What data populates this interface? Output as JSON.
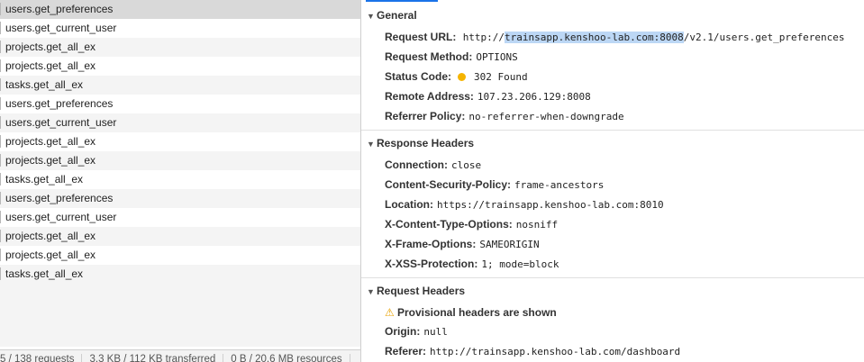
{
  "requests": [
    "users.get_preferences",
    "users.get_current_user",
    "projects.get_all_ex",
    "projects.get_all_ex",
    "tasks.get_all_ex",
    "users.get_preferences",
    "users.get_current_user",
    "projects.get_all_ex",
    "projects.get_all_ex",
    "tasks.get_all_ex",
    "users.get_preferences",
    "users.get_current_user",
    "projects.get_all_ex",
    "projects.get_all_ex",
    "tasks.get_all_ex"
  ],
  "status_bar": {
    "requests": "5 / 138 requests",
    "transferred": "3.3 KB / 112 KB transferred",
    "resources": "0 B / 20.6 MB resources"
  },
  "general": {
    "title": "General",
    "request_url_label": "Request URL:",
    "request_url_prefix": "http://",
    "request_url_host": "trainsapp.kenshoo-lab.com:8008",
    "request_url_path": "/v2.1/users.get_preferences",
    "request_method_label": "Request Method:",
    "request_method": "OPTIONS",
    "status_code_label": "Status Code:",
    "status_code": "302 Found",
    "status_color": "#f5b400",
    "remote_address_label": "Remote Address:",
    "remote_address": "107.23.206.129:8008",
    "referrer_policy_label": "Referrer Policy:",
    "referrer_policy": "no-referrer-when-downgrade"
  },
  "response_headers": {
    "title": "Response Headers",
    "items": [
      {
        "key": "Connection:",
        "value": "close"
      },
      {
        "key": "Content-Security-Policy:",
        "value": "frame-ancestors"
      },
      {
        "key": "Location:",
        "value": "https://trainsapp.kenshoo-lab.com:8010"
      },
      {
        "key": "X-Content-Type-Options:",
        "value": "nosniff"
      },
      {
        "key": "X-Frame-Options:",
        "value": "SAMEORIGIN"
      },
      {
        "key": "X-XSS-Protection:",
        "value": "1; mode=block"
      }
    ]
  },
  "request_headers": {
    "title": "Request Headers",
    "warning": "Provisional headers are shown",
    "items": [
      {
        "key": "Origin:",
        "value": "null"
      },
      {
        "key": "Referer:",
        "value": "http://trainsapp.kenshoo-lab.com/dashboard"
      }
    ]
  },
  "icons": {
    "expand": "triangle-down-icon",
    "warning": "warning-icon"
  },
  "colors": {
    "selected_row": "#d9d9d9",
    "url_highlight": "#bcd7f5",
    "tab_accent": "#1a73e8"
  }
}
